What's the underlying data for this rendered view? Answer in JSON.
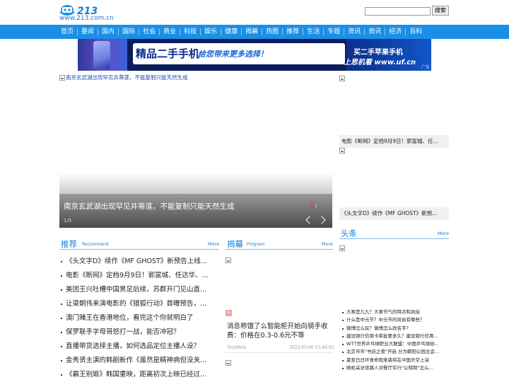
{
  "header": {
    "logo_text": "www.213.com.cn",
    "search_button": "搜索",
    "search_value": ""
  },
  "nav": [
    "首页",
    "要闻",
    "国内",
    "国际",
    "社会",
    "商业",
    "科技",
    "娱乐",
    "健康",
    "揭幕",
    "热图",
    "推荐",
    "生活",
    "专题",
    "资讯",
    "资讯",
    "经济",
    "百科"
  ],
  "banner": {
    "slogan_main": "精品二手手机",
    "slogan_sub": "给您带来更多选择！",
    "right_line1": "买二手苹果手机",
    "right_line2": "上思机看 www.uf.cn",
    "ad_tag": "广告"
  },
  "slideshow": {
    "alt_text": "南京玄武湖出现罕见井蒂莲，不能复制只能天然生成",
    "caption": "南京玄武湖出现罕见井蒂莲，不能复制只能天然生成",
    "current": "1",
    "separator": "/",
    "page": "1/5"
  },
  "right_stories": [
    {
      "caption": "电影《断网》定档9月9日！郭富城、任..."
    },
    {
      "caption": "《头文字D》续作《MF GHOST》新预..."
    }
  ],
  "recommend": {
    "title": "推荐",
    "subtitle": "Recommend",
    "more": "More",
    "items": [
      "《头文字D》续作《MF GHOST》新预告上线...",
      "电影《断网》定档9月9日！郭富城、任达华、...",
      "美团王兴吐槽中国男足后续，苏群开门见山直...",
      "让梁朝伟来演电影的《猎狐行动》首曝预告，...",
      "澳门赌王在香港地位，看完这个你就明白了",
      "保罗联手字母哥怒打一战，能否冲冠？",
      "直播带货选择主播，如何选品定位主播人设？",
      "金秀贤主演的韩剧新作《虽然是精神病但没关...",
      "《霸王别姬》韩国重映，距离初次上映已经过..."
    ]
  },
  "program": {
    "title": "揭幕",
    "subtitle": "Program",
    "more": "More",
    "badge": "头",
    "card_title": "消息称饿了么智能柜开始向骑手收费：价格在0.3-0.6元不等",
    "card_source": "TechWeb",
    "card_date": "2022-05-06 15:48:03"
  },
  "headlines": {
    "title": "头条",
    "more": "More",
    "items": [
      "大寒是几九？大寒节气的特点和风俗",
      "什么是中元节？中元节的风俗有哪些？",
      "微博怎么玩？微博怎么改名字？",
      "建设银行信用卡审批要多久？建设银行信用...",
      "WTT世界乒乓球职业大联盟：中国乒乓球协...",
      "北京市市\"书店之夜\"开启 分为朝阳公园主会...",
      "夏至日日环食奇观来袭将在中国天空上演",
      "随机采访该路人对餐厅实行\"公筷制\"怎么..."
    ]
  }
}
